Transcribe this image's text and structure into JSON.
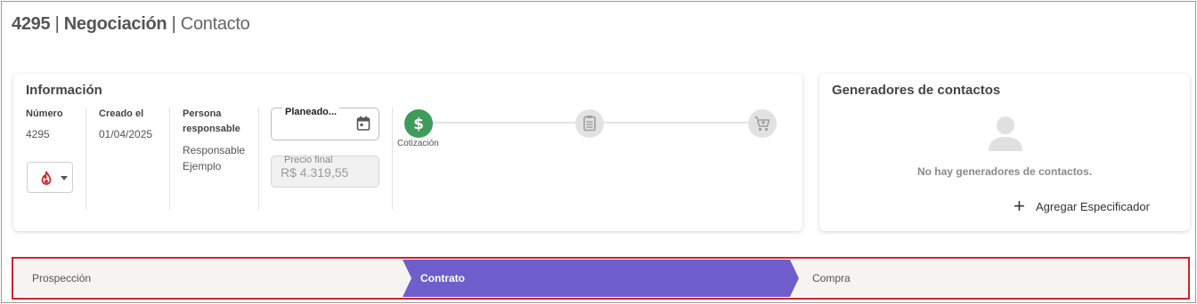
{
  "header": {
    "id": "4295",
    "separator": "|",
    "title": "Negociación",
    "subtitle": "Contacto"
  },
  "info_card": {
    "title": "Información",
    "numero_label": "Número",
    "numero_value": "4295",
    "creado_label": "Creado el",
    "creado_value": "01/04/2025",
    "persona_label_1": "Persona",
    "persona_label_2": "responsable",
    "persona_value_1": "Responsable",
    "persona_value_2": "Ejemplo",
    "date_field_label": "Planeado...",
    "price_label": "Precio final",
    "price_value": "R$ 4.319,55",
    "temperature_icon": "flame-icon",
    "steps": [
      {
        "label": "Cotización",
        "icon": "dollar-icon",
        "active": true
      },
      {
        "label": "",
        "icon": "document-icon",
        "active": false
      },
      {
        "label": "",
        "icon": "cart-icon",
        "active": false
      }
    ]
  },
  "generators_card": {
    "title": "Generadores de contactos",
    "empty_text": "No hay generadores de contactos.",
    "add_label": "Agregar Especificador"
  },
  "pipeline": {
    "stages": [
      {
        "label": "Prospección",
        "active": false
      },
      {
        "label": "Contrato",
        "active": true
      },
      {
        "label": "Compra",
        "active": false
      }
    ]
  },
  "colors": {
    "active_stage": "#6e5ecc",
    "inactive_stage": "#f6f3f1",
    "active_step": "#3e9b5c",
    "highlight_border": "#d0202a"
  }
}
